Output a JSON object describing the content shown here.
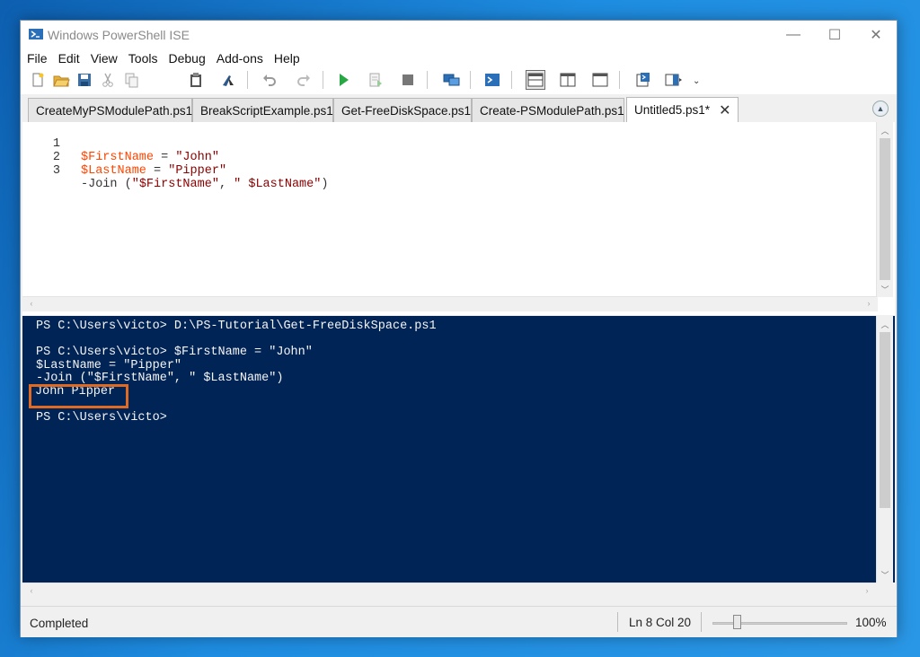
{
  "window": {
    "title": "Windows PowerShell ISE",
    "minimize_glyph": "—",
    "maximize_glyph": "☐",
    "close_glyph": "✕"
  },
  "menu": [
    "File",
    "Edit",
    "View",
    "Tools",
    "Debug",
    "Add-ons",
    "Help"
  ],
  "toolbar_icons": [
    "new-script-icon",
    "open-folder-icon",
    "save-icon",
    "cut-icon",
    "copy-icon",
    "paste-icon",
    "clear-console-icon",
    "undo-icon",
    "redo-icon",
    "run-script-icon",
    "run-selection-icon",
    "stop-icon",
    "remote-powershell-icon",
    "powershell-console-icon",
    "show-script-top-icon",
    "show-script-right-icon",
    "show-script-maximized-icon",
    "show-command-window-icon",
    "show-command-addon-icon"
  ],
  "toolbar_overflow": "⌄",
  "tabs": [
    {
      "label": "CreateMyPSModulePath.ps1"
    },
    {
      "label": "BreakScriptExample.ps1"
    },
    {
      "label": "Get-FreeDiskSpace.ps1"
    },
    {
      "label": "Create-PSModulePath.ps1"
    },
    {
      "label": "Untitled5.ps1*",
      "active": true,
      "close": "✕"
    }
  ],
  "editor": {
    "lines": [
      {
        "num": "1",
        "parts": [
          [
            "var",
            "$FirstName"
          ],
          [
            "op",
            " = "
          ],
          [
            "str",
            "\"John\""
          ]
        ]
      },
      {
        "num": "2",
        "parts": [
          [
            "var",
            "$LastName"
          ],
          [
            "op",
            " = "
          ],
          [
            "str",
            "\"Pipper\""
          ]
        ]
      },
      {
        "num": "3",
        "parts": [
          [
            "cmd",
            "-Join "
          ],
          [
            "op",
            "("
          ],
          [
            "str",
            "\"$FirstName\""
          ],
          [
            "op",
            ", "
          ],
          [
            "str",
            "\" $LastName\""
          ],
          [
            "op",
            ")"
          ]
        ]
      }
    ]
  },
  "console": {
    "lines": [
      "PS C:\\Users\\victo> D:\\PS-Tutorial\\Get-FreeDiskSpace.ps1",
      "",
      "PS C:\\Users\\victo> $FirstName = \"John\"",
      "$LastName = \"Pipper\"",
      "-Join (\"$FirstName\", \" $LastName\")",
      "John Pipper",
      "",
      "PS C:\\Users\\victo>"
    ],
    "highlighted_output": "John Pipper",
    "highlight_color": "#e06a22",
    "background": "#012456"
  },
  "status": {
    "text": "Completed",
    "line_col": "Ln 8  Col 20",
    "zoom_label": "100%",
    "zoom_level": 0.2
  }
}
